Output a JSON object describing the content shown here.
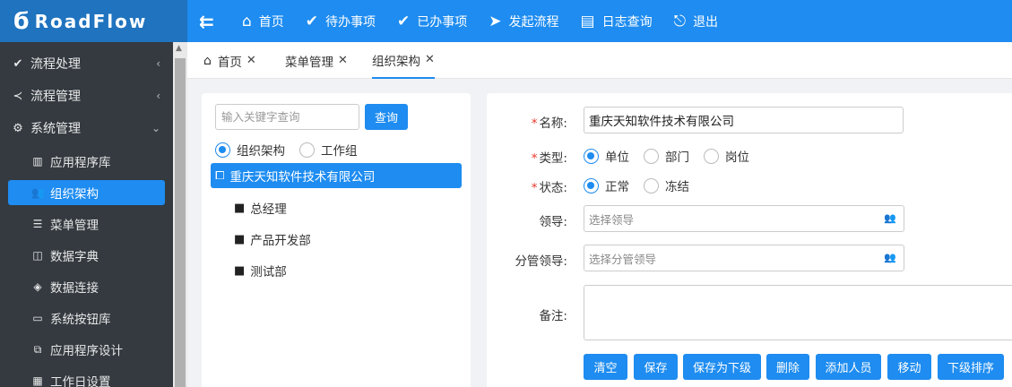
{
  "app": {
    "logo_text": "RoadFlow"
  },
  "topnav": [
    {
      "label": "首页",
      "icon": "home-icon"
    },
    {
      "label": "待办事项",
      "icon": "check-circle-icon"
    },
    {
      "label": "已办事项",
      "icon": "check-circle-icon"
    },
    {
      "label": "发起流程",
      "icon": "send-icon"
    },
    {
      "label": "日志查询",
      "icon": "log-icon"
    },
    {
      "label": "退出",
      "icon": "logout-icon"
    }
  ],
  "sidebar": {
    "groups": [
      {
        "label": "流程处理",
        "icon": "check-circle-icon"
      },
      {
        "label": "流程管理",
        "icon": "share-icon"
      },
      {
        "label": "系统管理",
        "icon": "gear-icon"
      }
    ],
    "items": [
      {
        "label": "应用程序库",
        "icon": "book-icon"
      },
      {
        "label": "组织架构",
        "icon": "users-icon",
        "active": true
      },
      {
        "label": "菜单管理",
        "icon": "menu-icon"
      },
      {
        "label": "数据字典",
        "icon": "dictionary-icon"
      },
      {
        "label": "数据连接",
        "icon": "database-icon"
      },
      {
        "label": "系统按钮库",
        "icon": "window-icon"
      },
      {
        "label": "应用程序设计",
        "icon": "briefcase-icon"
      },
      {
        "label": "工作日设置",
        "icon": "calendar-icon"
      }
    ]
  },
  "tabs": [
    {
      "label": "首页"
    },
    {
      "label": "菜单管理"
    },
    {
      "label": "组织架构",
      "active": true
    }
  ],
  "tree": {
    "search_placeholder": "输入关键字查询",
    "search_button": "查询",
    "mode_options": [
      "组织架构",
      "工作组"
    ],
    "mode_selected": "组织架构",
    "root": "重庆天知软件技术有限公司",
    "children": [
      "总经理",
      "产品开发部",
      "测试部"
    ]
  },
  "form": {
    "name_label": "名称:",
    "name_value": "重庆天知软件技术有限公司",
    "type_label": "类型:",
    "type_options": [
      "单位",
      "部门",
      "岗位"
    ],
    "type_selected": "单位",
    "status_label": "状态:",
    "status_options": [
      "正常",
      "冻结"
    ],
    "status_selected": "正常",
    "leader_label": "领导:",
    "leader_placeholder": "选择领导",
    "sub_leader_label": "分管领导:",
    "sub_leader_placeholder": "选择分管领导",
    "note_label": "备注:",
    "buttons": [
      "清空",
      "保存",
      "保存为下级",
      "删除",
      "添加人员",
      "移动",
      "下级排序"
    ]
  },
  "colors": {
    "primary": "#1e8cf0",
    "sidebar_bg": "#343a40",
    "logo_bg": "#1f73bf",
    "required": "#e8362b"
  }
}
